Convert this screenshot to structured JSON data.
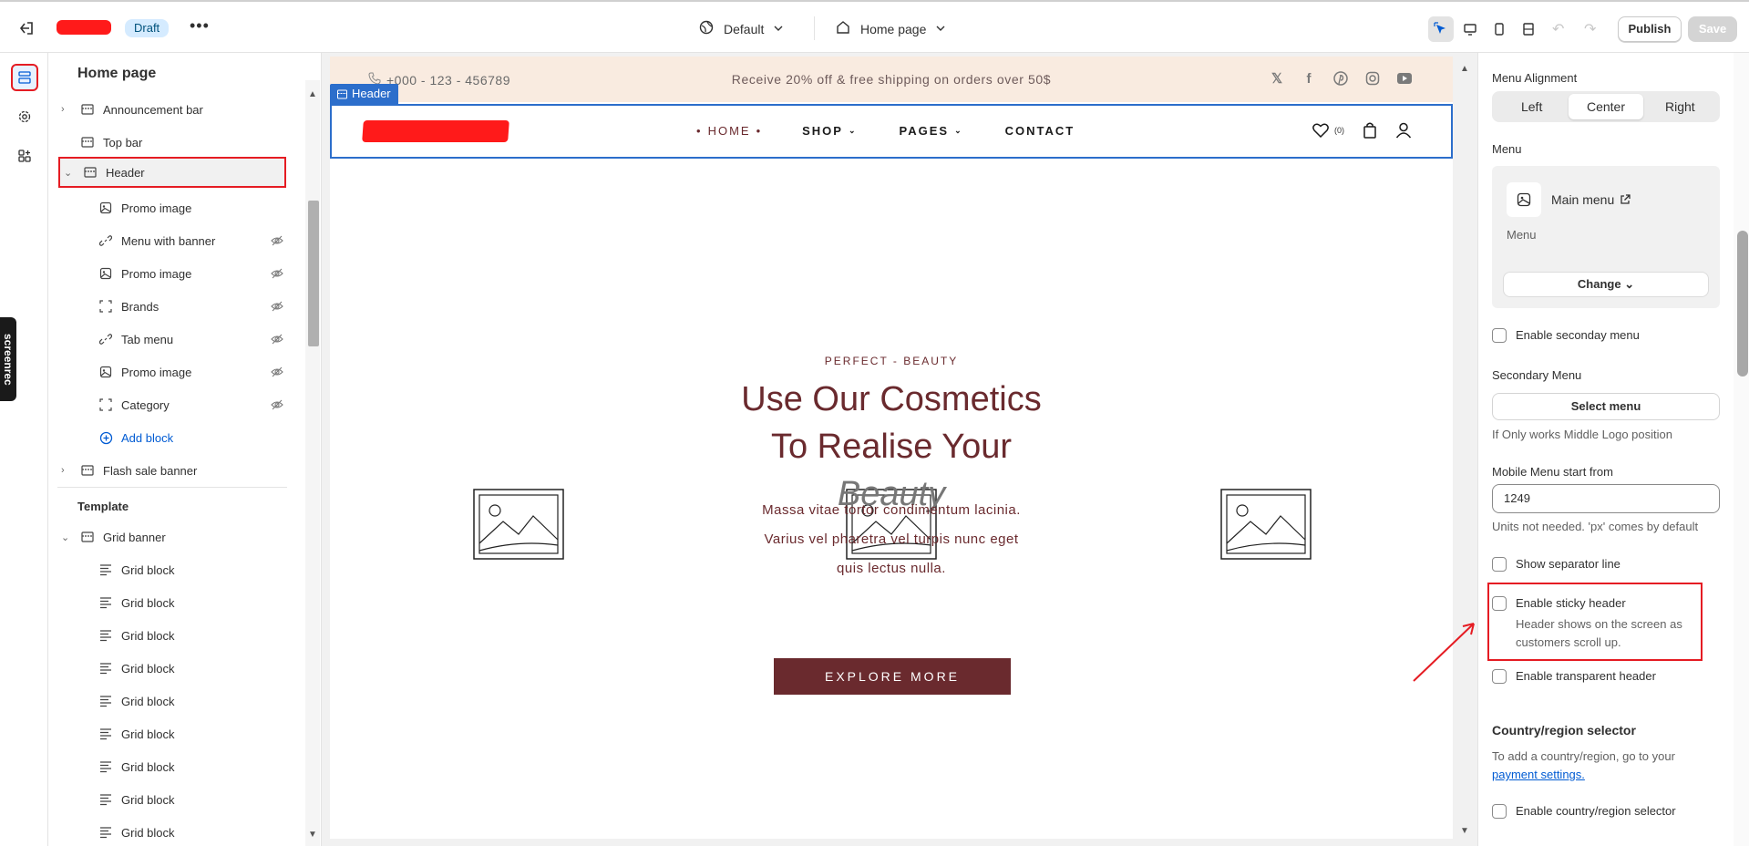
{
  "topbar": {
    "status_badge": "Draft",
    "more": "•••",
    "theme": "Default",
    "page": "Home page",
    "publish": "Publish",
    "save": "Save"
  },
  "screenrec": "screenrec",
  "sections": {
    "title": "Home page",
    "items": [
      {
        "label": "Announcement bar"
      },
      {
        "label": "Top bar"
      },
      {
        "label": "Header"
      },
      {
        "label": "Promo image"
      },
      {
        "label": "Menu with banner"
      },
      {
        "label": "Promo image"
      },
      {
        "label": "Brands"
      },
      {
        "label": "Tab menu"
      },
      {
        "label": "Promo image"
      },
      {
        "label": "Category"
      },
      {
        "label": "Add block"
      },
      {
        "label": "Flash sale banner"
      }
    ],
    "template_heading": "Template",
    "grid_banner": "Grid banner",
    "grid_blocks": [
      "Grid block",
      "Grid block",
      "Grid block",
      "Grid block",
      "Grid block",
      "Grid block",
      "Grid block",
      "Grid block",
      "Grid block"
    ]
  },
  "preview": {
    "phone": "+000 - 123 - 456789",
    "announcement": "Receive 20% off & free shipping on orders over 50$",
    "header_tag": "Header",
    "nav": [
      "HOME",
      "SHOP",
      "PAGES",
      "CONTACT"
    ],
    "wish_count": "(0)",
    "hero_sub": "PERFECT - BEAUTY",
    "hero_title_1": "Use Our Cosmetics",
    "hero_title_2": "To Realise Your",
    "hero_title_3": "Beauty",
    "hero_body_1": "Massa vitae tortor condimentum lacinia.",
    "hero_body_2": "Varius vel pharetra vel turpis nunc eget",
    "hero_body_3": "quis lectus nulla.",
    "hero_button": "EXPLORE MORE",
    "colors": {
      "brand": "#6a2a2e",
      "announcement_bg": "#f9ebe0",
      "selection": "#2c6ecb"
    }
  },
  "settings": {
    "menu_alignment_label": "Menu Alignment",
    "alignment_options": [
      "Left",
      "Center",
      "Right"
    ],
    "alignment_selected": "Center",
    "menu_label": "Menu",
    "menu_name": "Main menu",
    "menu_sub": "Menu",
    "change_button": "Change",
    "enable_secondary": "Enable seconday menu",
    "secondary_menu_label": "Secondary Menu",
    "select_menu": "Select menu",
    "secondary_help": "If Only works Middle Logo position",
    "mobile_menu_label": "Mobile Menu start from",
    "mobile_menu_value": "1249",
    "mobile_help": "Units not needed. 'px' comes by default",
    "show_separator": "Show separator line",
    "sticky_label": "Enable sticky header",
    "sticky_help": "Header shows on the screen as customers scroll up.",
    "transparent_label": "Enable transparent header",
    "country_heading": "Country/region selector",
    "country_help": "To add a country/region, go to your",
    "country_link": "payment settings.",
    "country_enable": "Enable country/region selector"
  }
}
